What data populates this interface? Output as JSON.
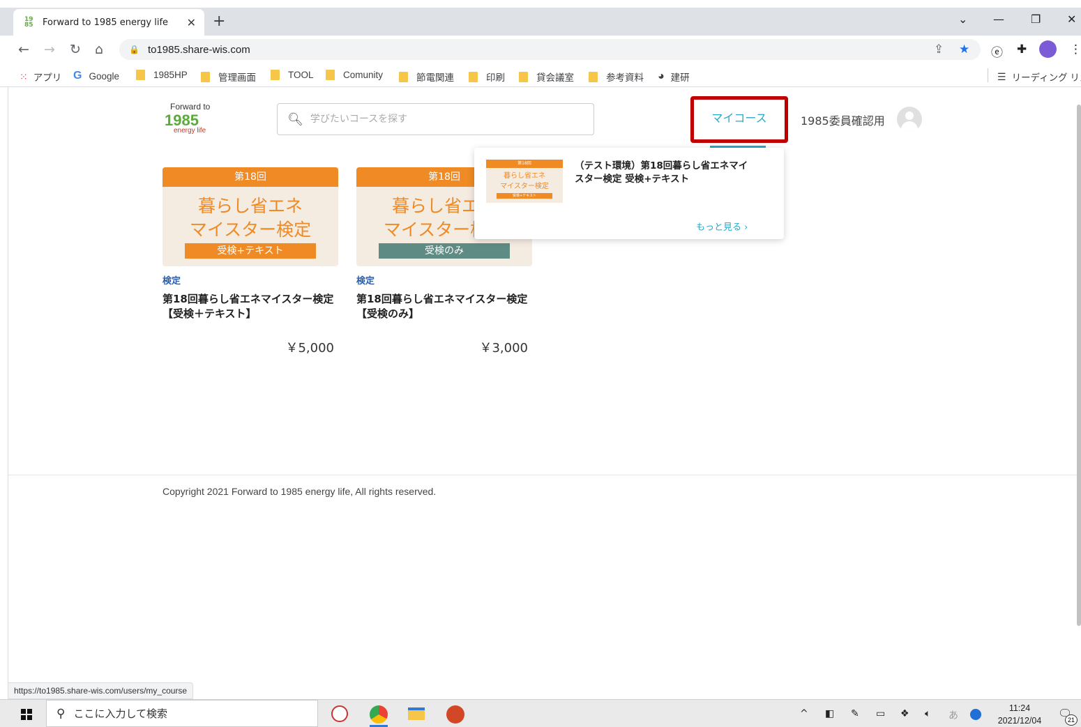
{
  "browser": {
    "tab_title": "Forward to 1985 energy life",
    "favicon_text": "19\n85",
    "tab_close": "✕",
    "new_tab": "+",
    "url": "to1985.share-wis.com",
    "window_controls": {
      "dropdown": "⌄",
      "minimize": "—",
      "restore": "❐",
      "close": "✕"
    }
  },
  "bookmarks": {
    "apps": "アプリ",
    "google": "Google",
    "items": [
      "1985HP",
      "管理画面",
      "TOOL",
      "Comunity",
      "節電関連",
      "印刷",
      "貸会議室",
      "参考資料"
    ],
    "kenken": "建研",
    "reading_list": "リーディング リスト"
  },
  "header": {
    "logo_top": "Forward to",
    "logo_main": "1985",
    "logo_bottom": "energy life",
    "search_placeholder": "学びたいコースを探す",
    "my_course": "マイコース",
    "username": "1985委員確認用"
  },
  "courses": [
    {
      "band": "第18回",
      "line1": "暮らし省エネ",
      "line2": "マイスター検定",
      "sub": "受検+テキスト",
      "sub_color": "#f08a24",
      "category": "検定",
      "title": "第18回暮らし省エネマイスター検定 【受検＋テキスト】",
      "price": "￥5,000"
    },
    {
      "band": "第18回",
      "line1": "暮らし省エネ",
      "line2": "マイスター検定",
      "sub": "受検のみ",
      "sub_color": "#5e8b84",
      "category": "検定",
      "title": "第18回暮らし省エネマイスター検定 【受検のみ】",
      "price": "￥3,000"
    }
  ],
  "dropdown": {
    "thumb_band": "第18回",
    "thumb_line1": "暮らし省エネ",
    "thumb_line2": "マイスター検定",
    "thumb_sub": "受検+テキスト",
    "title": "（テスト環境）第18回暮らし省エネマイスター検定 受検+テキスト",
    "more": "もっと見る ›"
  },
  "footer": {
    "copyright": "Copyright 2021 Forward to 1985 energy life, All rights reserved."
  },
  "status_url": "https://to1985.share-wis.com/users/my_course",
  "taskbar": {
    "search_placeholder": "ここに入力して検索",
    "ime": "あ",
    "time": "11:24",
    "date": "2021/12/04",
    "notification_count": "21"
  },
  "colors": {
    "accent": "#28a8c8",
    "brand_orange": "#f08a24",
    "highlight_red": "#c00000",
    "category_blue": "#2a5fb0"
  }
}
